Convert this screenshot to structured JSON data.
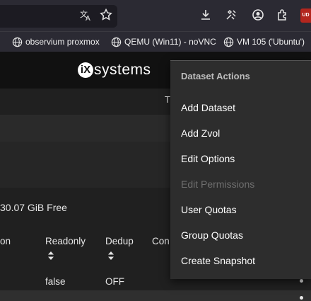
{
  "browser": {
    "bookmarks": [
      {
        "label": "observium proxmox"
      },
      {
        "label": "QEMU (Win11) - noVNC"
      },
      {
        "label": "VM 105 ('Ubuntu')"
      }
    ],
    "extension_badge": "UD"
  },
  "header": {
    "logo_mark": "iX",
    "logo_text": "systems"
  },
  "page": {
    "partial_title": "T",
    "free_space": "30.07 GiB Free",
    "table": {
      "headers": [
        "on",
        "Readonly",
        "Dedup",
        "Con"
      ],
      "row": [
        "false",
        "OFF"
      ]
    }
  },
  "menu": {
    "title": "Dataset Actions",
    "items": [
      {
        "label": "Add Dataset",
        "enabled": true
      },
      {
        "label": "Add Zvol",
        "enabled": true
      },
      {
        "label": "Edit Options",
        "enabled": true
      },
      {
        "label": "Edit Permissions",
        "enabled": false
      },
      {
        "label": "User Quotas",
        "enabled": true
      },
      {
        "label": "Group Quotas",
        "enabled": true
      },
      {
        "label": "Create Snapshot",
        "enabled": true
      }
    ]
  },
  "colors": {
    "menu_bg": "#2d2d2d",
    "topbar_bg": "#111111",
    "disabled_text": "#6f6f6f"
  }
}
